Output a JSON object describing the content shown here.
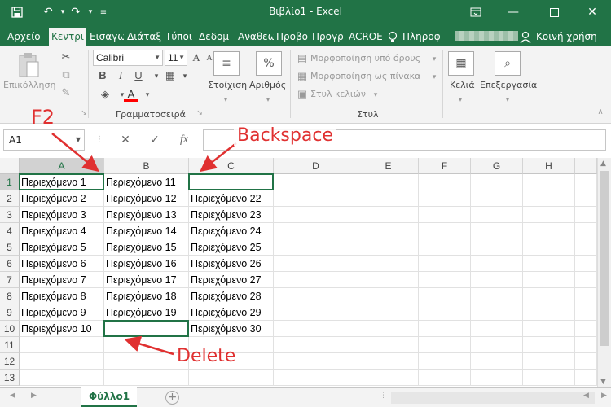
{
  "window": {
    "title": "Βιβλίο1 - Excel",
    "icons": {
      "save": "save-icon",
      "undo": "undo-icon",
      "redo": "redo-icon",
      "customize": "customize-qat-icon"
    }
  },
  "tabs": [
    {
      "label": "Αρχείο",
      "active": false
    },
    {
      "label": "Κεντρι",
      "active": true
    },
    {
      "label": "Εισαγω",
      "active": false
    },
    {
      "label": "Διάταξ",
      "active": false
    },
    {
      "label": "Τύποι",
      "active": false
    },
    {
      "label": "Δεδομ",
      "active": false
    },
    {
      "label": "Αναθεω",
      "active": false
    },
    {
      "label": "Προβο",
      "active": false
    },
    {
      "label": "Προγρ",
      "active": false
    },
    {
      "label": "ACROE",
      "active": false
    },
    {
      "label": "Πληροφ",
      "active": false
    }
  ],
  "share_label": "Κοινή χρήση",
  "ribbon": {
    "paste_label": "Επικόλληση",
    "clipboard_group": "",
    "font_name": "Calibri",
    "font_size": "11",
    "font_group": "Γραμματοσειρά",
    "alignment_label": "Στοίχιση",
    "number_label": "Αριθμός",
    "number_symbol": "%",
    "cond_format": "Μορφοποίηση υπό όρους",
    "format_table": "Μορφοποίηση ως πίνακα",
    "cell_styles": "Στυλ κελιών",
    "styles_group": "Στυλ",
    "cells_label": "Κελιά",
    "editing_label": "Επεξεργασία",
    "bold": "B",
    "italic": "I",
    "underline": "U",
    "font_color_letter": "A"
  },
  "formula_bar": {
    "name_box": "A1",
    "fx": "fx",
    "value": ""
  },
  "columns": [
    "A",
    "B",
    "C",
    "D",
    "E",
    "F",
    "G",
    "H"
  ],
  "rows": [
    "1",
    "2",
    "3",
    "4",
    "5",
    "6",
    "7",
    "8",
    "9",
    "10",
    "11",
    "12",
    "13"
  ],
  "cells": {
    "A": [
      "Περιεχόμενο 1",
      "Περιεχόμενο 2",
      "Περιεχόμενο 3",
      "Περιεχόμενο 4",
      "Περιεχόμενο 5",
      "Περιεχόμενο 6",
      "Περιεχόμενο 7",
      "Περιεχόμενο 8",
      "Περιεχόμενο 9",
      "Περιεχόμενο 10"
    ],
    "B": [
      "Περιεχόμενο 11",
      "Περιεχόμενο 12",
      "Περιεχόμενο 13",
      "Περιεχόμενο 14",
      "Περιεχόμενο 15",
      "Περιεχόμενο 16",
      "Περιεχόμενο 17",
      "Περιεχόμενο 18",
      "Περιεχόμενο 19",
      ""
    ],
    "C": [
      "",
      "Περιεχόμενο 22",
      "Περιεχόμενο 23",
      "Περιεχόμενο 24",
      "Περιεχόμενο 25",
      "Περιεχόμενο 26",
      "Περιεχόμενο 27",
      "Περιεχόμενο 28",
      "Περιεχόμενο 29",
      "Περιεχόμενο 30"
    ]
  },
  "sheet_tab": "Φύλλο1",
  "annotations": {
    "f2": "F2",
    "backspace": "Backspace",
    "delete": "Delete"
  },
  "colors": {
    "accent": "#217346",
    "annotation": "#e03030"
  }
}
